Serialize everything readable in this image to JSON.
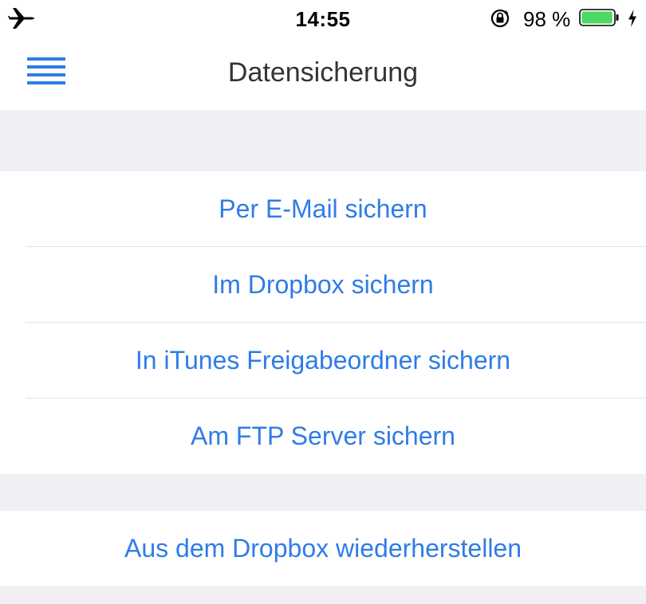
{
  "status_bar": {
    "time": "14:55",
    "battery_percent": "98 %",
    "battery_level": 0.98,
    "airplane_icon": "airplane-icon",
    "rotation_lock_icon": "rotation-lock-icon",
    "battery_icon": "battery-icon",
    "charging_icon": "charging-bolt-icon",
    "battery_color": "#4cd964"
  },
  "nav_bar": {
    "title": "Datensicherung",
    "menu_icon": "hamburger-menu-icon"
  },
  "backup_options": [
    {
      "label": "Per E-Mail sichern"
    },
    {
      "label": "Im Dropbox sichern"
    },
    {
      "label": "In iTunes Freigabeordner sichern"
    },
    {
      "label": "Am FTP Server sichern"
    }
  ],
  "restore_options": [
    {
      "label": "Aus dem Dropbox wiederherstellen"
    }
  ],
  "colors": {
    "accent": "#2f7ce7",
    "background": "#efeff4",
    "cell_background": "#ffffff",
    "separator": "#e3e3e8"
  }
}
